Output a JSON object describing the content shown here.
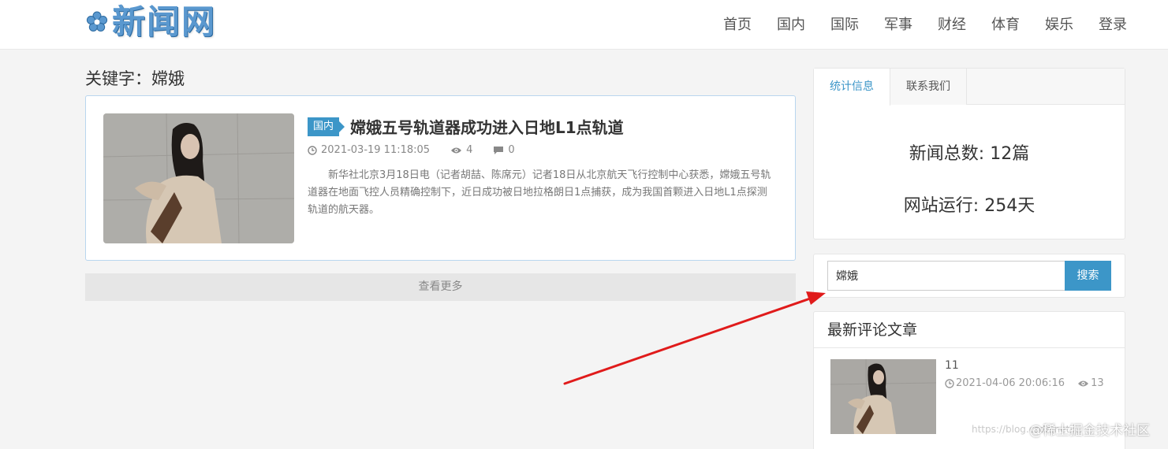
{
  "site": {
    "logo_text": "新闻网",
    "nav": [
      "首页",
      "国内",
      "国际",
      "军事",
      "财经",
      "体育",
      "娱乐",
      "登录"
    ]
  },
  "search_result": {
    "keyword_title": "关键字：嫦娥"
  },
  "article": {
    "tag": "国内",
    "title": "嫦娥五号轨道器成功进入日地L1点轨道",
    "date": "2021-03-19 11:18:05",
    "views": "4",
    "comments": "0",
    "summary": "新华社北京3月18日电（记者胡喆、陈席元）记者18日从北京航天飞行控制中心获悉，嫦娥五号轨道器在地面飞控人员精确控制下，近日成功被日地拉格朗日1点捕获，成为我国首颗进入日地L1点探测轨道的航天器。"
  },
  "more_label": "查看更多",
  "stats": {
    "tab_active": "统计信息",
    "tab_other": "联系我们",
    "news_total": "新闻总数: 12篇",
    "site_running": "网站运行: 254天"
  },
  "search": {
    "value": "嫦娥",
    "button": "搜索"
  },
  "latest": {
    "heading": "最新评论文章",
    "item_title": "11",
    "item_date": "2021-04-06 20:06:16",
    "item_views": "13"
  },
  "watermark": {
    "url": "https://blog.csdn.net/...",
    "text": "@稀土掘金技术社区"
  },
  "colors": {
    "accent": "#3c96c8",
    "arrow": "#e01b1b",
    "logo": "#5a98cf"
  }
}
